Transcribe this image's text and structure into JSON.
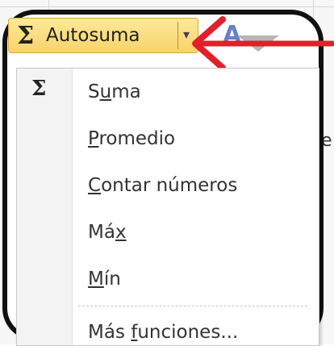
{
  "autosum": {
    "symbol": "Σ",
    "label": "Autosuma",
    "arrow": "▾"
  },
  "sort_icon": {
    "letter": "A"
  },
  "background_text": {
    "cell": "e"
  },
  "menu": {
    "symbol": "Σ",
    "items": [
      {
        "pre": "S",
        "u": "u",
        "post": "ma",
        "full": "Suma"
      },
      {
        "pre": "",
        "u": "P",
        "post": "romedio",
        "full": "Promedio"
      },
      {
        "pre": "",
        "u": "C",
        "post": "ontar números",
        "full": "Contar números"
      },
      {
        "pre": "Má",
        "u": "x",
        "post": "",
        "full": "Máx"
      },
      {
        "pre": "",
        "u": "M",
        "post": "ín",
        "full": "Mín"
      },
      {
        "pre": "Más ",
        "u": "f",
        "post": "unciones...",
        "full": "Más funciones..."
      }
    ]
  },
  "colors": {
    "frame": "#111111",
    "autosum_fill": "#f8d36a",
    "annotation_arrow": "#e0202a"
  }
}
